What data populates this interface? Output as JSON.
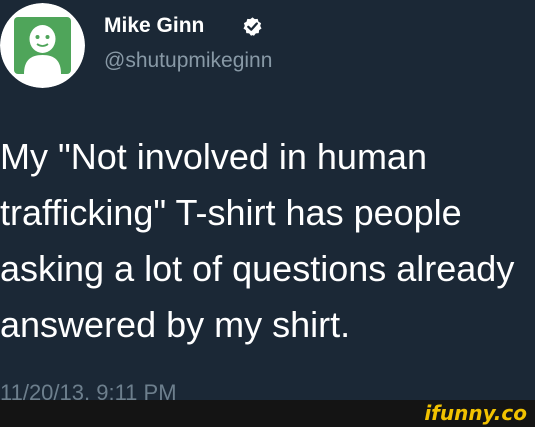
{
  "tweet": {
    "author": {
      "display_name": "Mike Ginn",
      "handle": "@shutupmikeginn",
      "verified": true,
      "avatar_icon": "avatar-icon"
    },
    "text_lines": [
      "My \"Not involved in human",
      "trafficking\" T-shirt has people",
      "asking a lot of questions already",
      "answered by my shirt."
    ],
    "timestamp": "11/20/13, 9:11 PM"
  },
  "watermark": {
    "text": "ifunny.co"
  },
  "colors": {
    "background": "#1b2836",
    "handle": "#8899a6",
    "timestamp": "#6d7f8d",
    "verified_badge": "#ffffff",
    "watermark": "#f2c200",
    "avatar_green": "#4fa55a"
  }
}
